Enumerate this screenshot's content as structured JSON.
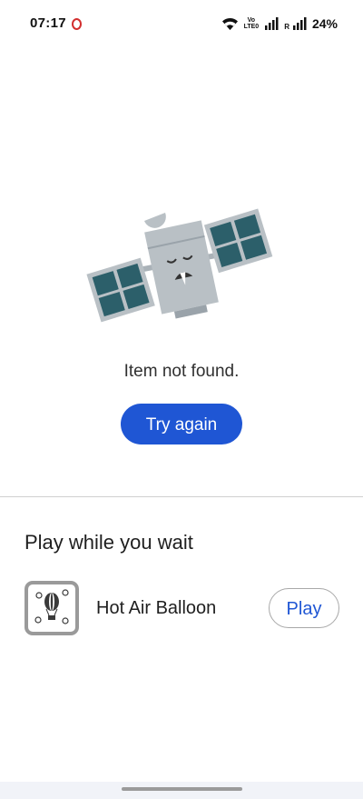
{
  "status_bar": {
    "time": "07:17",
    "volte_top": "Vo",
    "volte_bottom": "LTE0",
    "roaming": "R",
    "battery": "24%"
  },
  "error": {
    "illustration": "sad-satellite-illustration",
    "message": "Item not found.",
    "retry_label": "Try again"
  },
  "games": {
    "section_title": "Play while you wait",
    "items": [
      {
        "name": "Hot Air Balloon",
        "icon": "hot-air-balloon-icon",
        "action_label": "Play"
      }
    ]
  },
  "colors": {
    "accent": "#1f56d4",
    "satellite_panel": "#2c5f6a",
    "satellite_body": "#b9c0c5"
  }
}
